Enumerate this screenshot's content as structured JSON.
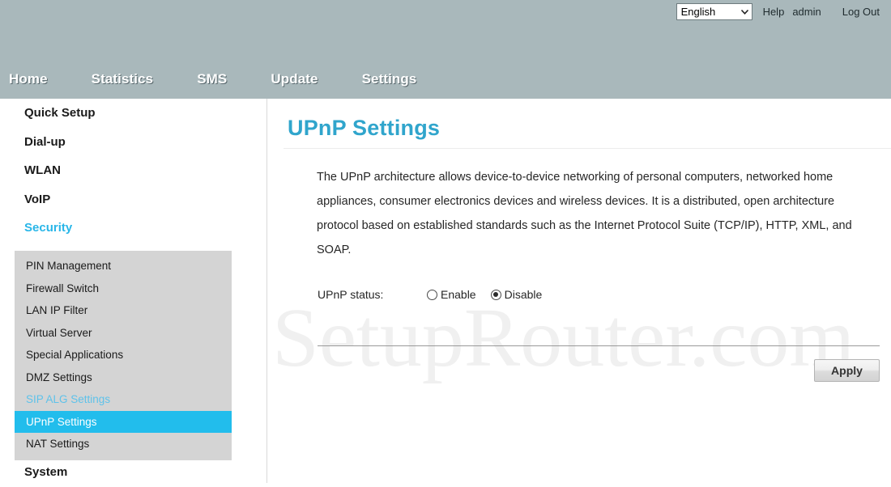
{
  "topbar": {
    "language_selected": "English",
    "language_options": [
      "English"
    ],
    "help_label": "Help",
    "user_label": "admin",
    "logout_label": "Log Out"
  },
  "mainnav": {
    "items": [
      {
        "label": "Home"
      },
      {
        "label": "Statistics"
      },
      {
        "label": "SMS"
      },
      {
        "label": "Update"
      },
      {
        "label": "Settings"
      }
    ]
  },
  "sidebar": {
    "top_items": [
      {
        "label": "Quick Setup",
        "active": false
      },
      {
        "label": "Dial-up",
        "active": false
      },
      {
        "label": "WLAN",
        "active": false
      },
      {
        "label": "VoIP",
        "active": false
      },
      {
        "label": "Security",
        "active": true
      }
    ],
    "submenu": [
      {
        "label": "PIN Management",
        "state": "normal"
      },
      {
        "label": "Firewall Switch",
        "state": "normal"
      },
      {
        "label": "LAN IP Filter",
        "state": "normal"
      },
      {
        "label": "Virtual Server",
        "state": "normal"
      },
      {
        "label": "Special Applications",
        "state": "normal"
      },
      {
        "label": "DMZ Settings",
        "state": "normal"
      },
      {
        "label": "SIP ALG Settings",
        "state": "visited"
      },
      {
        "label": "UPnP Settings",
        "state": "selected"
      },
      {
        "label": "NAT Settings",
        "state": "normal"
      }
    ],
    "bottom_items": [
      {
        "label": "System",
        "active": false
      }
    ]
  },
  "main": {
    "title": "UPnP Settings",
    "description": "The UPnP architecture allows device-to-device networking of personal computers, networked home appliances, consumer electronics devices and wireless devices. It is a distributed, open architecture protocol based on established standards such as the Internet Protocol Suite (TCP/IP), HTTP, XML, and SOAP.",
    "status_label": "UPnP status:",
    "radio_enable_label": "Enable",
    "radio_disable_label": "Disable",
    "selected_status": "Disable",
    "apply_label": "Apply"
  },
  "watermark": {
    "text": "SetupRouter.com"
  },
  "colors": {
    "header_band": "#a9b8bb",
    "accent_cyan": "#22bdec",
    "title_blue": "#30a5cc",
    "submenu_gray": "#d4d4d4",
    "visited_blue": "#5ec2ea"
  }
}
